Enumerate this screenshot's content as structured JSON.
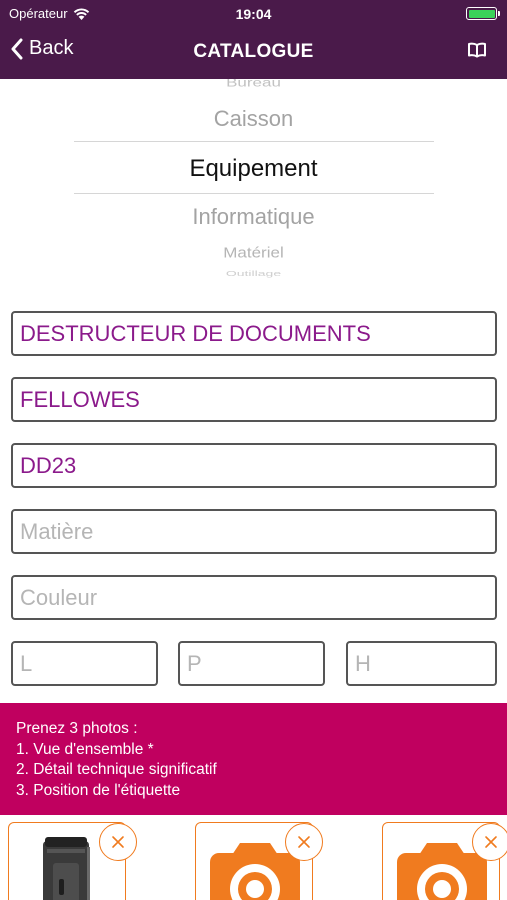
{
  "status_bar": {
    "carrier": "Opérateur",
    "time": "19:04"
  },
  "nav": {
    "back_label": "Back",
    "title": "CATALOGUE"
  },
  "picker": {
    "items_above": [
      "Bureau",
      "Caisson"
    ],
    "selected": "Equipement",
    "items_below": [
      "Informatique",
      "Matériel",
      "Outillage"
    ]
  },
  "form": {
    "designation": "DESTRUCTEUR DE DOCUMENTS",
    "brand": "FELLOWES",
    "model": "DD23",
    "material_placeholder": "Matière",
    "color_placeholder": "Couleur",
    "length_placeholder": "L",
    "depth_placeholder": "P",
    "height_placeholder": "H"
  },
  "instructions": {
    "heading": "Prenez 3 photos :",
    "step1": "1. Vue d'ensemble *",
    "step2": "2. Détail technique significatif",
    "step3": "3. Position de l'étiquette"
  },
  "colors": {
    "nav": "#4a1a4a",
    "accent": "#c0005f",
    "field_text": "#8b1a8b",
    "photo_border": "#f07b1f"
  },
  "icons": [
    "wifi-icon",
    "battery-icon",
    "chevron-left-icon",
    "book-icon",
    "close-icon",
    "camera-icon"
  ]
}
